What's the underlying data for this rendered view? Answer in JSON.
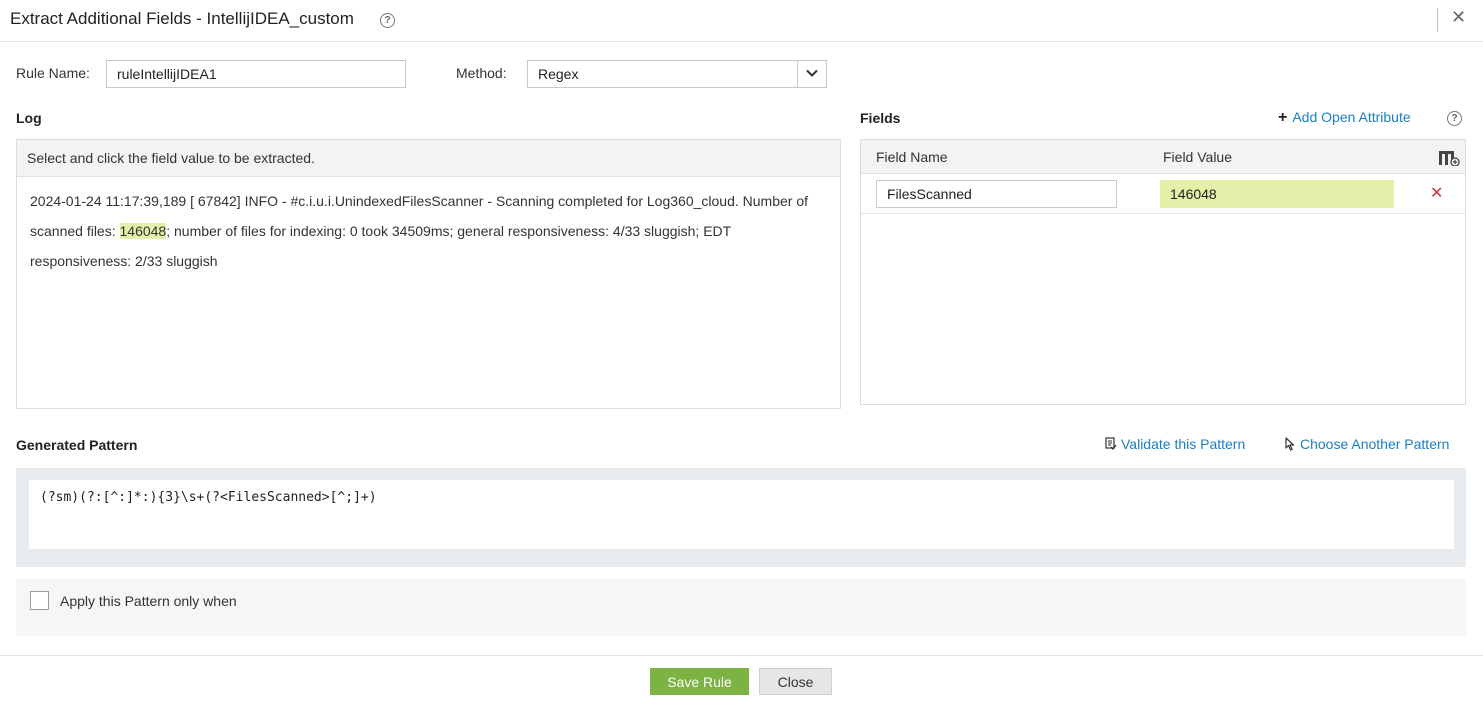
{
  "dialog": {
    "title": "Extract Additional Fields - IntellijIDEA_custom",
    "help_icon": "question-circle-icon",
    "close_icon": "close-icon"
  },
  "rule": {
    "name_label": "Rule Name:",
    "name_value": "ruleIntellijIDEA1",
    "method_label": "Method:",
    "method_value": "Regex"
  },
  "log": {
    "title": "Log",
    "hint": "Select and click the field value to be extracted.",
    "text_before": "2024-01-24 11:17:39,189 [ 67842] INFO - #c.i.u.i.UnindexedFilesScanner - Scanning completed for Log360_cloud. Number of scanned files: ",
    "highlight": "146048",
    "text_after": "; number of files for indexing: 0 took 34509ms; general responsiveness: 4/33 sluggish; EDT responsiveness: 2/33 sluggish"
  },
  "fields": {
    "title": "Fields",
    "add_attribute": "Add Open Attribute",
    "col_name": "Field Name",
    "col_value": "Field Value",
    "rows": [
      {
        "name": "FilesScanned",
        "value": "146048"
      }
    ]
  },
  "pattern": {
    "title": "Generated Pattern",
    "validate": "Validate this Pattern",
    "choose": "Choose Another Pattern",
    "value": "(?sm)(?:[^:]*:){3}\\s+(?<FilesScanned>[^;]+)"
  },
  "condition": {
    "label": "Apply this Pattern only when"
  },
  "footer": {
    "save": "Save Rule",
    "close": "Close"
  },
  "colors": {
    "accent": "#7cb342",
    "link": "#1a7fbf",
    "highlight": "#e2f0a9",
    "delete": "#d9303a"
  }
}
